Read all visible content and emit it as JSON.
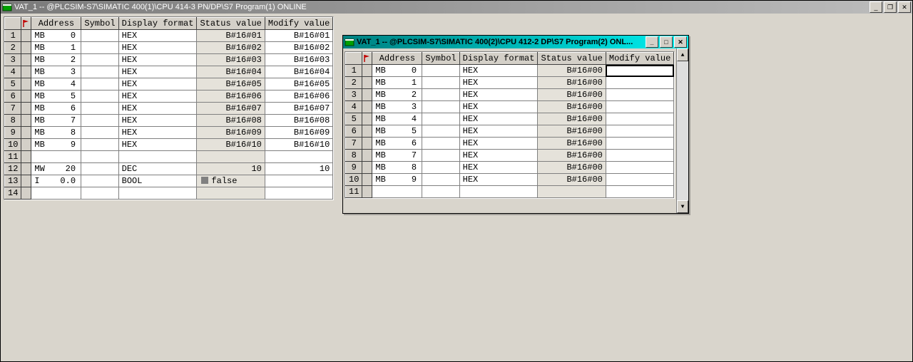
{
  "outer": {
    "title": "VAT_1 -- @PLCSIM-S7\\SIMATIC 400(1)\\CPU 414-3 PN/DP\\S7 Program(1)  ONLINE",
    "columns": {
      "address": "Address",
      "symbol": "Symbol",
      "format": "Display format",
      "status": "Status value",
      "modify": "Modify value"
    },
    "rows": [
      {
        "n": "1",
        "address": "MB     0",
        "symbol": "",
        "format": "HEX",
        "status": "B#16#01",
        "modify": "B#16#01"
      },
      {
        "n": "2",
        "address": "MB     1",
        "symbol": "",
        "format": "HEX",
        "status": "B#16#02",
        "modify": "B#16#02"
      },
      {
        "n": "3",
        "address": "MB     2",
        "symbol": "",
        "format": "HEX",
        "status": "B#16#03",
        "modify": "B#16#03"
      },
      {
        "n": "4",
        "address": "MB     3",
        "symbol": "",
        "format": "HEX",
        "status": "B#16#04",
        "modify": "B#16#04"
      },
      {
        "n": "5",
        "address": "MB     4",
        "symbol": "",
        "format": "HEX",
        "status": "B#16#05",
        "modify": "B#16#05"
      },
      {
        "n": "6",
        "address": "MB     5",
        "symbol": "",
        "format": "HEX",
        "status": "B#16#06",
        "modify": "B#16#06"
      },
      {
        "n": "7",
        "address": "MB     6",
        "symbol": "",
        "format": "HEX",
        "status": "B#16#07",
        "modify": "B#16#07"
      },
      {
        "n": "8",
        "address": "MB     7",
        "symbol": "",
        "format": "HEX",
        "status": "B#16#08",
        "modify": "B#16#08"
      },
      {
        "n": "9",
        "address": "MB     8",
        "symbol": "",
        "format": "HEX",
        "status": "B#16#09",
        "modify": "B#16#09"
      },
      {
        "n": "10",
        "address": "MB     9",
        "symbol": "",
        "format": "HEX",
        "status": "B#16#10",
        "modify": "B#16#10"
      },
      {
        "n": "11",
        "address": "",
        "symbol": "",
        "format": "",
        "status": "",
        "modify": ""
      },
      {
        "n": "12",
        "address": "MW    20",
        "symbol": "",
        "format": "DEC",
        "status": "10",
        "modify": "10"
      },
      {
        "n": "13",
        "address": "I    0.0",
        "symbol": "",
        "format": "BOOL",
        "status": "false",
        "modify": "",
        "status_style": "falseval"
      },
      {
        "n": "14",
        "address": "",
        "symbol": "",
        "format": "",
        "status": "",
        "modify": ""
      }
    ]
  },
  "child": {
    "title": "VAT_1 -- @PLCSIM-S7\\SIMATIC 400(2)\\CPU 412-2 DP\\S7 Program(2)  ONL...",
    "columns": {
      "address": "Address",
      "symbol": "Symbol",
      "format": "Display format",
      "status": "Status value",
      "modify": "Modify value"
    },
    "rows": [
      {
        "n": "1",
        "address": "MB     0",
        "symbol": "",
        "format": "HEX",
        "status": "B#16#00",
        "modify": "",
        "selected": true
      },
      {
        "n": "2",
        "address": "MB     1",
        "symbol": "",
        "format": "HEX",
        "status": "B#16#00",
        "modify": ""
      },
      {
        "n": "3",
        "address": "MB     2",
        "symbol": "",
        "format": "HEX",
        "status": "B#16#00",
        "modify": ""
      },
      {
        "n": "4",
        "address": "MB     3",
        "symbol": "",
        "format": "HEX",
        "status": "B#16#00",
        "modify": ""
      },
      {
        "n": "5",
        "address": "MB     4",
        "symbol": "",
        "format": "HEX",
        "status": "B#16#00",
        "modify": ""
      },
      {
        "n": "6",
        "address": "MB     5",
        "symbol": "",
        "format": "HEX",
        "status": "B#16#00",
        "modify": ""
      },
      {
        "n": "7",
        "address": "MB     6",
        "symbol": "",
        "format": "HEX",
        "status": "B#16#00",
        "modify": ""
      },
      {
        "n": "8",
        "address": "MB     7",
        "symbol": "",
        "format": "HEX",
        "status": "B#16#00",
        "modify": ""
      },
      {
        "n": "9",
        "address": "MB     8",
        "symbol": "",
        "format": "HEX",
        "status": "B#16#00",
        "modify": ""
      },
      {
        "n": "10",
        "address": "MB     9",
        "symbol": "",
        "format": "HEX",
        "status": "B#16#00",
        "modify": ""
      },
      {
        "n": "11",
        "address": "",
        "symbol": "",
        "format": "",
        "status": "",
        "modify": ""
      }
    ]
  },
  "icons": {
    "minimize": "_",
    "maximize": "□",
    "restore": "❐",
    "close": "✕",
    "up": "▲",
    "down": "▼"
  }
}
